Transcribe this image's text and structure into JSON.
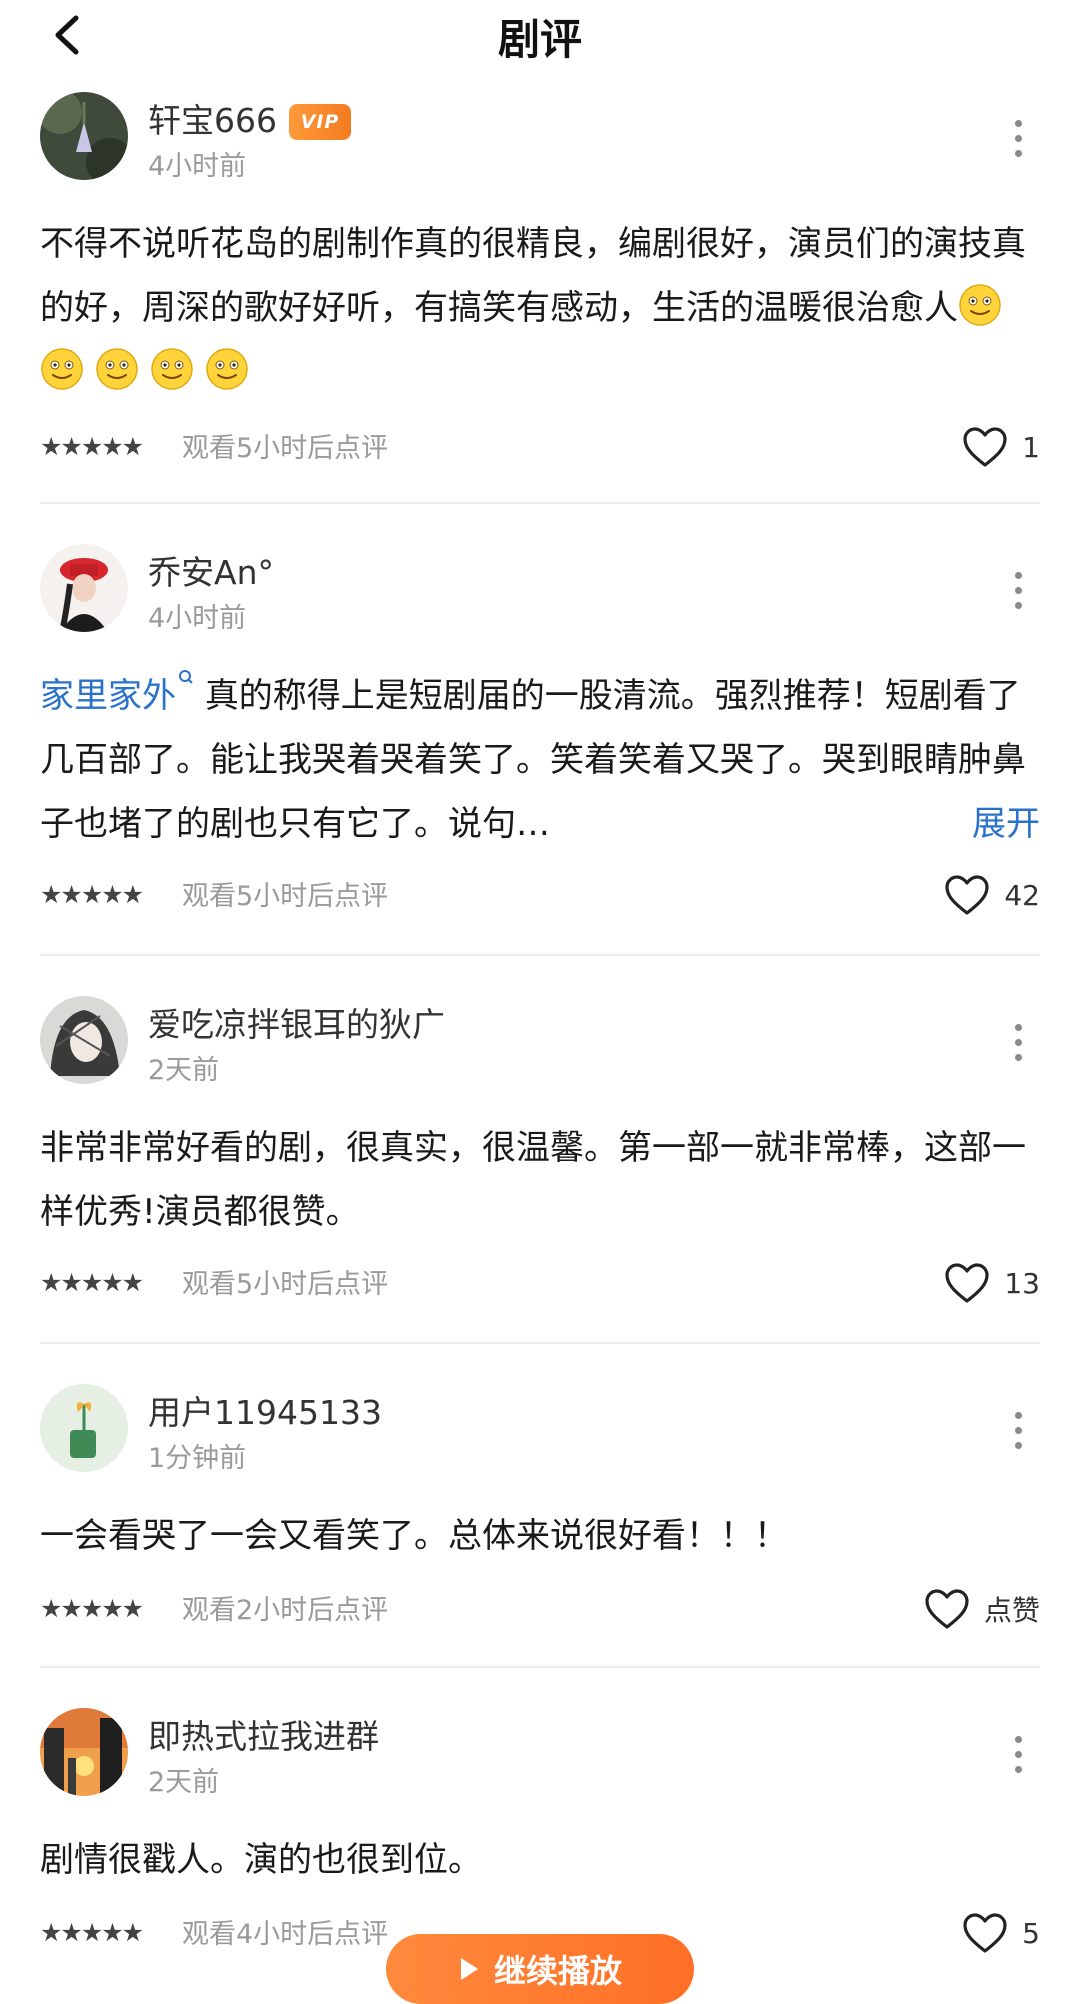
{
  "header": {
    "title": "剧评"
  },
  "colors": {
    "accent": "#ff7a2f",
    "link": "#2a72c9",
    "vip": "#f47b20"
  },
  "reviews": [
    {
      "username": "轩宝666",
      "vip": "VIP",
      "time": "4小时前",
      "avatar_icon": "flower-photo-avatar",
      "content": "不得不说听花岛的剧制作真的很精良，编剧很好，演员们的演技真的好，周深的歌好好听，有搞笑有感动，生活的温暖很治愈人",
      "emoji_count": 5,
      "stars": 5,
      "watch_note": "观看5小时后点评",
      "likes": "1"
    },
    {
      "username": "乔安An°",
      "time": "4小时前",
      "avatar_icon": "girl-red-hat-avatar",
      "topic": "家里家外",
      "content": "真的称得上是短剧届的一股清流。强烈推荐！短剧看了几百部了。能让我哭着哭着笑了。笑着笑着又哭了。哭到眼睛肿鼻子也堵了的剧也只有它了。说句…",
      "expand": "展开",
      "stars": 5,
      "watch_note": "观看5小时后点评",
      "likes": "42"
    },
    {
      "username": "爱吃凉拌银耳的狄广",
      "time": "2天前",
      "avatar_icon": "sketch-girl-avatar",
      "content": "非常非常好看的剧，很真实，很温馨。第一部一就非常棒，这部一样优秀!演员都很赞。",
      "stars": 5,
      "watch_note": "观看5小时后点评",
      "likes": "13"
    },
    {
      "username": "用户11945133",
      "time": "1分钟前",
      "avatar_icon": "default-plant-avatar",
      "content": "一会看哭了一会又看笑了。总体来说很好看！！！",
      "stars": 5,
      "watch_note": "观看2小时后点评",
      "likes": "点赞"
    },
    {
      "username": "即热式拉我进群",
      "time": "2天前",
      "avatar_icon": "sunset-city-avatar",
      "content": "剧情很戳人。演的也很到位。",
      "stars": 5,
      "watch_note": "观看4小时后点评",
      "likes": "5"
    }
  ],
  "cta": {
    "label": "继续播放",
    "icon": "play-icon"
  }
}
